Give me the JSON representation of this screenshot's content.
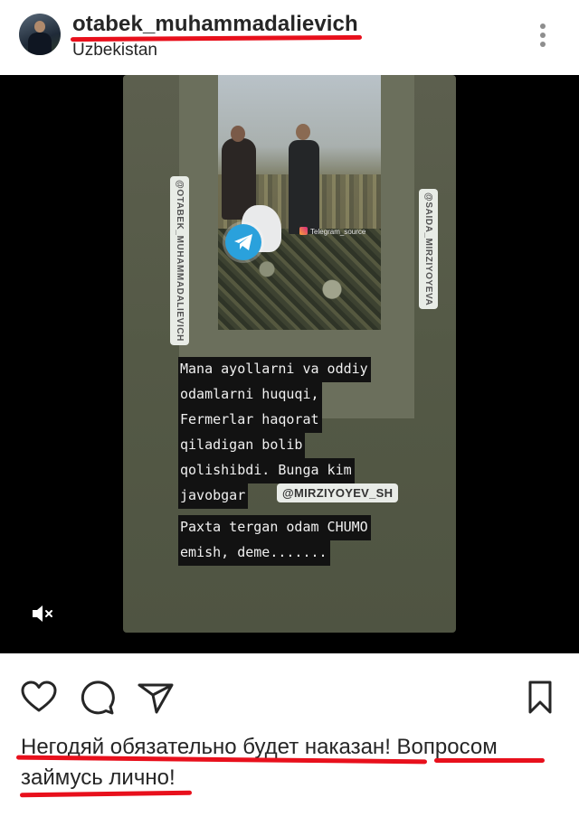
{
  "header": {
    "username": "otabek_muhammadalievich",
    "location": "Uzbekistan",
    "avatar_icon": "profile-avatar",
    "more_icon": "more-vertical-icon"
  },
  "media": {
    "left_watermark": "@OTABEK_MUHAMMADALIEVICH",
    "right_watermark": "@SAIDA_MIRZIYOYEVA",
    "photo_caption": "Telegram_source",
    "story_text_lines": [
      "Mana ayollarni va oddiy",
      "odamlarni huquqi,",
      "Fermerlar haqorat",
      "qiladigan bolib",
      "qolishibdi.  Bunga kim",
      "javobgar"
    ],
    "mention": "@MIRZIYOYEV_SH",
    "story_text_lines_2": [
      "Paxta tergan odam CHUMO",
      "emish, deme......."
    ],
    "mute_icon": "mute-speaker-icon"
  },
  "actions": {
    "like_icon": "heart-icon",
    "comment_icon": "comment-icon",
    "share_icon": "send-icon",
    "save_icon": "bookmark-icon"
  },
  "caption": {
    "part1": "Негодяй обязательно будет наказан!",
    "part2": "Вопросом",
    "part3": "займусь лично!"
  },
  "colors": {
    "highlight_underline": "#e8101c",
    "telegram_blue": "#2aa1dc",
    "text": "#262626"
  }
}
